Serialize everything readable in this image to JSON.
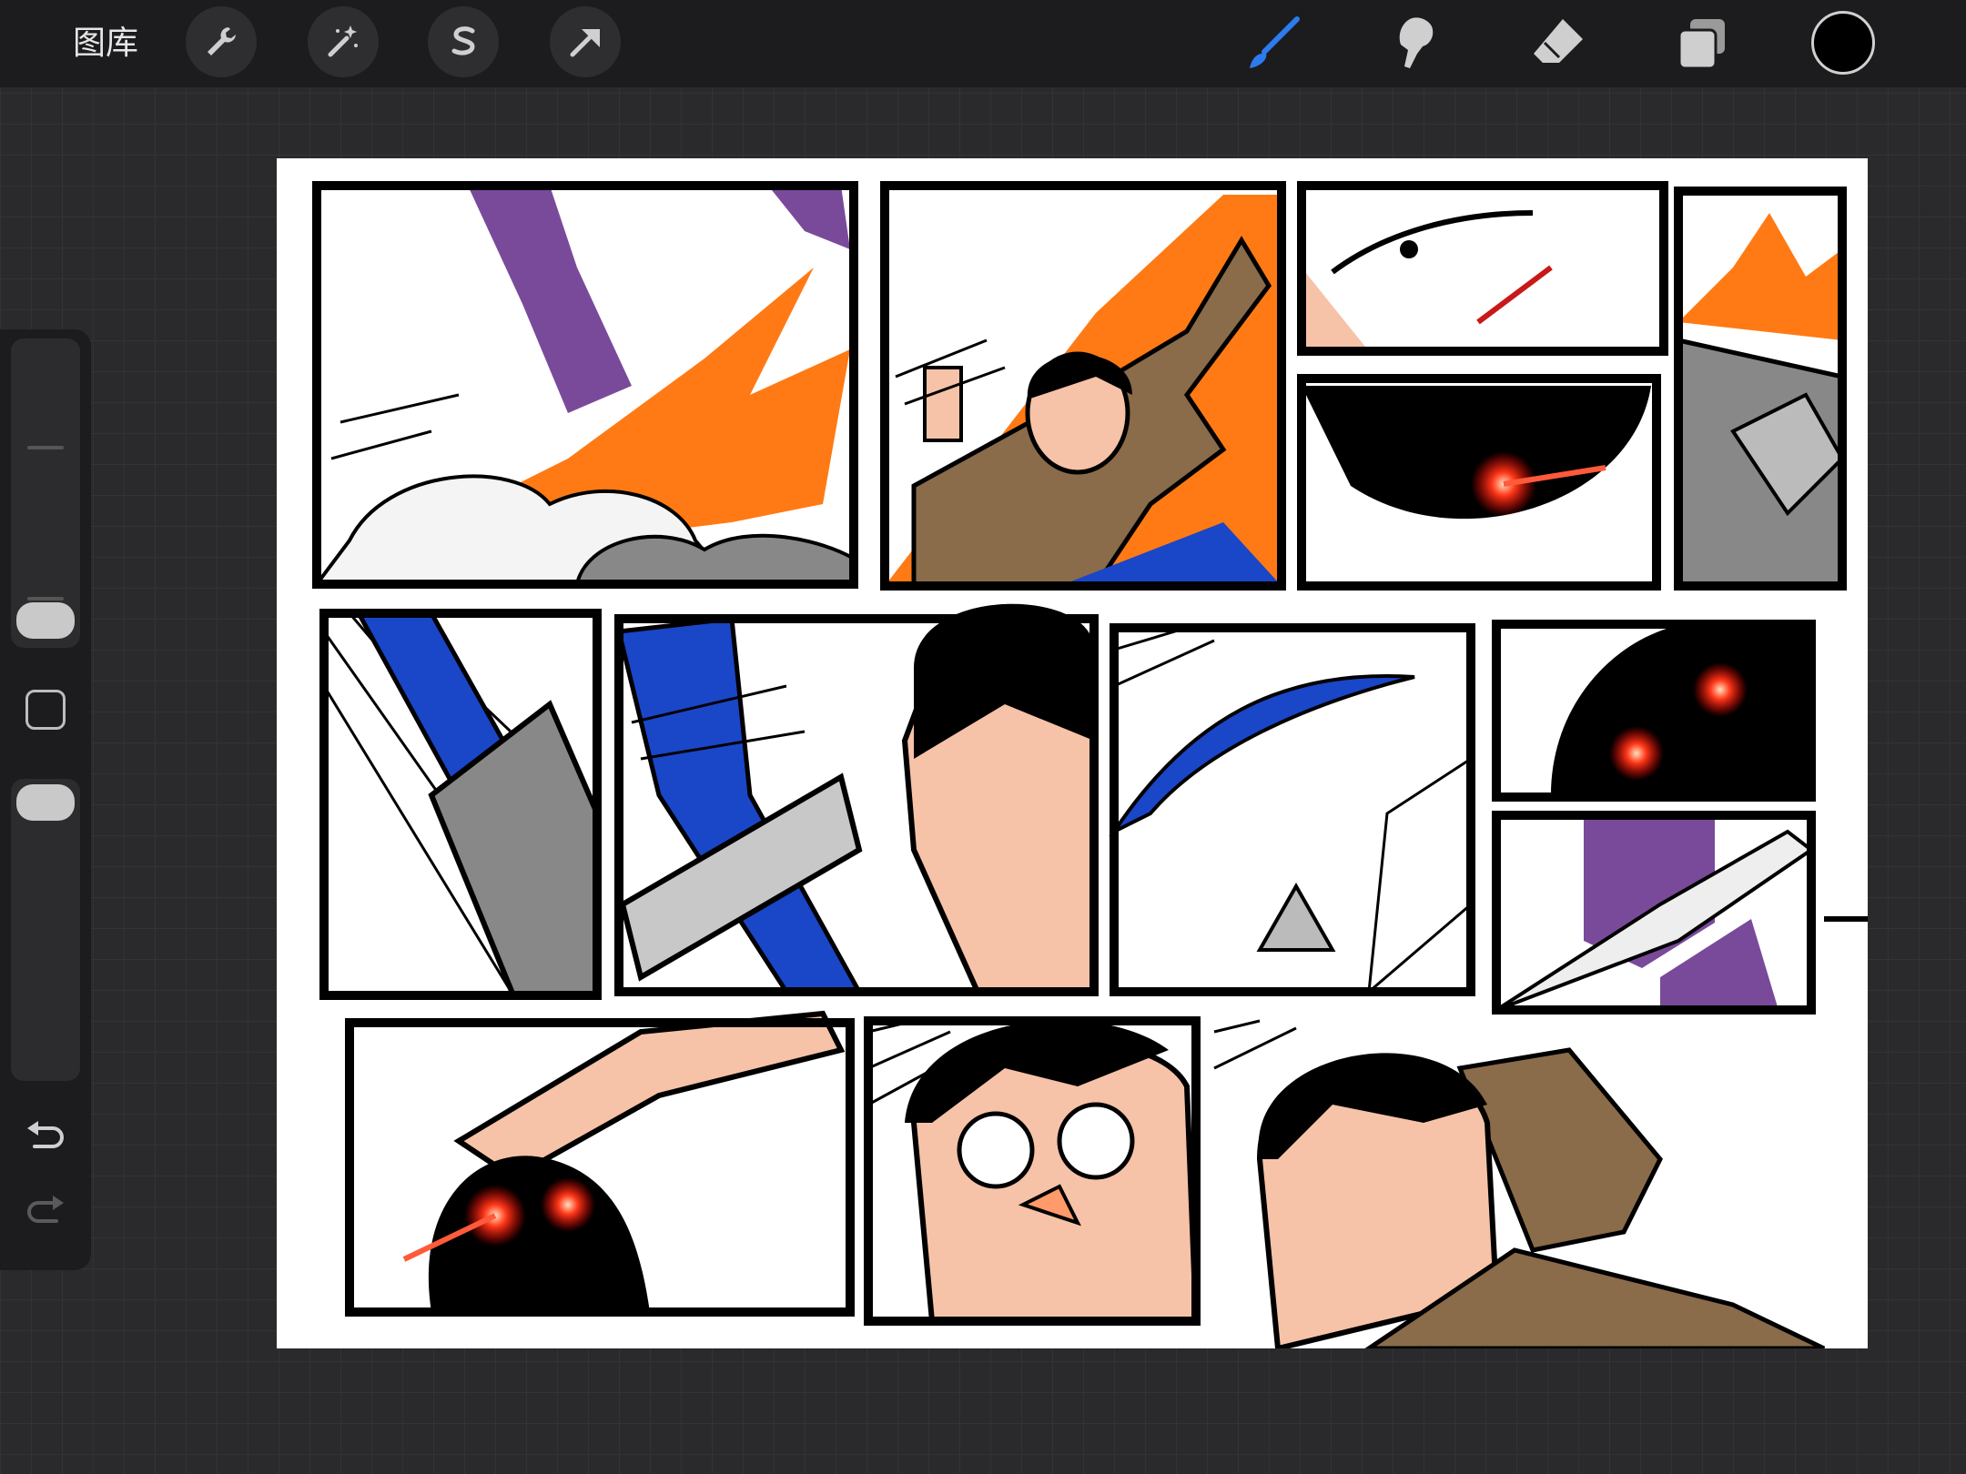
{
  "topbar": {
    "gallery_label": "图库",
    "left_tools": [
      "wrench-icon",
      "magic-wand-icon",
      "selection-s-icon",
      "transform-arrow-icon"
    ],
    "right_tools": [
      "brush-icon",
      "smudge-icon",
      "eraser-icon",
      "layers-icon"
    ],
    "active_tool": "brush-icon",
    "current_color": "#000000"
  },
  "sidebar": {
    "brush_size_level": 0.12,
    "opacity_level": 0.97,
    "controls": [
      "brush-size-slider",
      "modify-button",
      "opacity-slider",
      "undo-icon",
      "redo-icon"
    ]
  },
  "canvas": {
    "content": "comic-page-artwork",
    "accent_colors": {
      "orange": "#ff7a14",
      "purple": "#7a4a9a",
      "blue": "#1a46c8",
      "brown": "#8a6b4a",
      "skin": "#f6c3a8",
      "red_glow": "#ff2a1a"
    }
  }
}
